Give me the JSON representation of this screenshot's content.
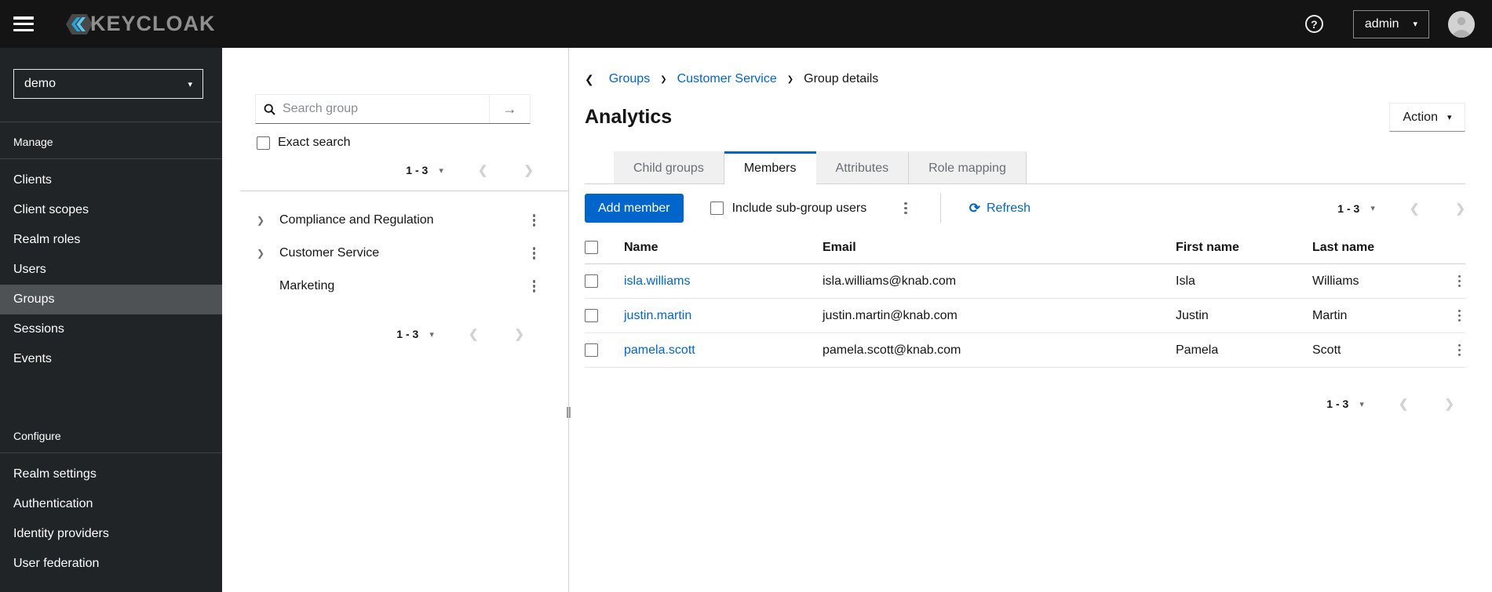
{
  "topbar": {
    "brand": "KEYCLOAK",
    "help": "?",
    "user": "admin"
  },
  "sidebar": {
    "realm": "demo",
    "manage": {
      "label": "Manage",
      "items": [
        "Clients",
        "Client scopes",
        "Realm roles",
        "Users",
        "Groups",
        "Sessions",
        "Events"
      ]
    },
    "configure": {
      "label": "Configure",
      "items": [
        "Realm settings",
        "Authentication",
        "Identity providers",
        "User federation"
      ]
    },
    "active_item": "Groups"
  },
  "tree": {
    "search_placeholder": "Search group",
    "search_value": "",
    "exact_search_label": "Exact search",
    "pagination_top": {
      "range": "1 - 3"
    },
    "items": [
      {
        "name": "Compliance and Regulation",
        "expandable": true
      },
      {
        "name": "Customer Service",
        "expandable": true
      },
      {
        "name": "Marketing",
        "expandable": false
      }
    ],
    "pagination_bottom": {
      "range": "1 - 3"
    }
  },
  "main": {
    "breadcrumb": {
      "items": [
        "Groups",
        "Customer Service",
        "Group details"
      ]
    },
    "title": "Analytics",
    "action_button": "Action",
    "tabs": [
      "Child groups",
      "Members",
      "Attributes",
      "Role mapping"
    ],
    "active_tab": "Members",
    "toolbar": {
      "add_member": "Add member",
      "include_subgroups": "Include sub-group users",
      "refresh": "Refresh",
      "pagination": {
        "range": "1 - 3"
      }
    },
    "table": {
      "headers": [
        "Name",
        "Email",
        "First name",
        "Last name"
      ],
      "rows": [
        {
          "name": "isla.williams",
          "email": "isla.williams@knab.com",
          "first_name": "Isla",
          "last_name": "Williams"
        },
        {
          "name": "justin.martin",
          "email": "justin.martin@knab.com",
          "first_name": "Justin",
          "last_name": "Martin"
        },
        {
          "name": "pamela.scott",
          "email": "pamela.scott@knab.com",
          "first_name": "Pamela",
          "last_name": "Scott"
        }
      ]
    },
    "pagination_bottom": {
      "range": "1 - 3"
    }
  },
  "icons": {
    "caret_down": "▾",
    "chevron_right": "❯",
    "chevron_left": "❮",
    "arrow_right": "→",
    "refresh": "⟳",
    "question": "?"
  },
  "colors": {
    "primary": "#0066cc",
    "link": "#0066cc",
    "topbar_bg": "#141414",
    "sidebar_bg": "#212427",
    "sidebar_active_bg": "#4f5255",
    "tab_inactive_bg": "#f0f0f0",
    "border": "#d2d2d2",
    "disabled": "#d2d2d2"
  }
}
